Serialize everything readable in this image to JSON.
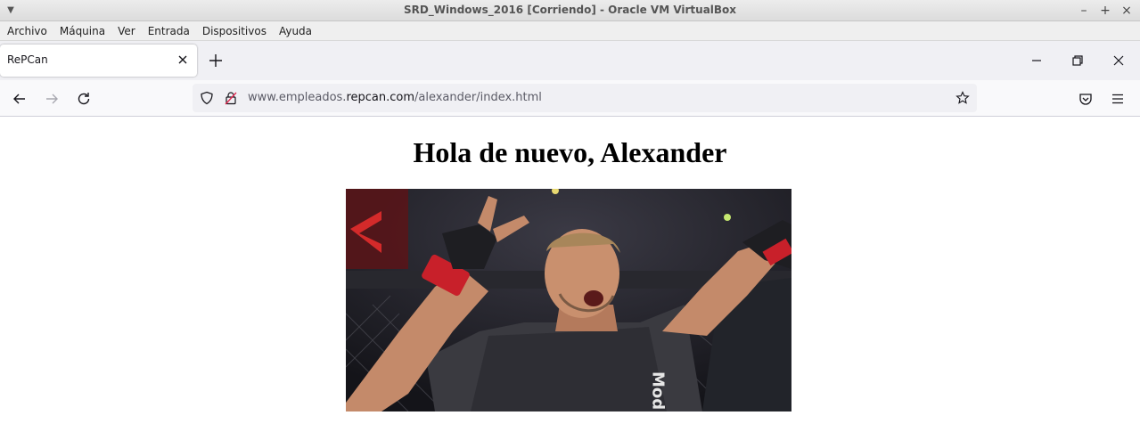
{
  "vbox": {
    "title": "SRD_Windows_2016 [Corriendo] - Oracle VM VirtualBox",
    "menu": [
      "Archivo",
      "Máquina",
      "Ver",
      "Entrada",
      "Dispositivos",
      "Ayuda"
    ],
    "controls": [
      "–",
      "+",
      "×"
    ]
  },
  "browser": {
    "tab_title": "RePCan",
    "url_prefix": "www.empleados.",
    "url_domain": "repcan.com",
    "url_path": "/alexander/index.html"
  },
  "page": {
    "heading": "Hola de nuevo, Alexander",
    "photo_text": "Mod"
  },
  "colors": {
    "accent_red": "#c8202a",
    "toolbar_bg": "#f9f9fb"
  }
}
